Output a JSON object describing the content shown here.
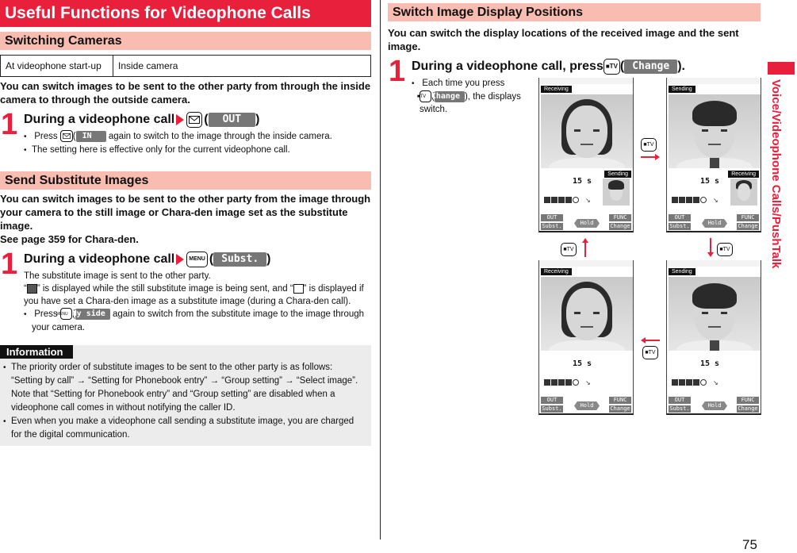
{
  "page": {
    "number": "75",
    "side_tab": "Voice/Videophone Calls/PushTalk",
    "accent_color": "#e8203c",
    "subheading_color": "#f8bcb0"
  },
  "left": {
    "title": "Useful Functions for Videophone Calls",
    "switching_cameras": {
      "heading": "Switching Cameras",
      "table": [
        {
          "setting": "At videophone start-up",
          "value": "Inside camera"
        }
      ],
      "lead": "You can switch images to be sent to the other party from through the inside camera to through the outside camera.",
      "step": {
        "number": "1",
        "title": "During a videophone call",
        "key_icon": "mail-key-icon",
        "softkey": "OUT",
        "bullets": [
          {
            "pre": "Press ",
            "softkey": "IN",
            "post": " again to switch to the image through the inside camera."
          },
          {
            "text": "The setting here is effective only for the current videophone call."
          }
        ]
      }
    },
    "send_substitute": {
      "heading": "Send Substitute Images",
      "lead": "You can switch images to be sent to the other party from the image through your camera to the still image or Chara-den image set as the substitute image.",
      "lead2": "See page 359 for Chara-den.",
      "step": {
        "number": "1",
        "title": "During a videophone call",
        "key_label": "MENU",
        "softkey": "Subst.",
        "body1": "The substitute image is sent to the other party.",
        "body2a": "“",
        "body2b": "” is displayed while the still substitute image is being sent, and “",
        "body2c": "” is displayed if you have set a Chara-den image as a substitute image (during a Chara-den call).",
        "bullet_pre": "Press ",
        "bullet_softkey": "My side",
        "bullet_post": " again to switch from the substitute image to the image through your camera."
      }
    },
    "information": {
      "tag": "Information",
      "items": [
        "The priority order of substitute images to be sent to the other party is as follows: “Setting by call” → “Setting for Phonebook entry” → “Group setting” → “Select image”. Note that “Setting for Phonebook entry” and “Group setting” are disabled when a videophone call comes in without notifying the caller ID.",
        "Even when you make a videophone call sending a substitute image, you are charged for the digital communication."
      ]
    }
  },
  "right": {
    "heading": "Switch Image Display Positions",
    "lead": "You can switch the display locations of the received image and the sent image.",
    "step": {
      "number": "1",
      "title_pre": "During a videophone call, press ",
      "key_label": "■TV",
      "softkey": "Change",
      "title_post": ").",
      "bullet_pre": "Each time you press",
      "bullet_softkey": "Change",
      "bullet_post": "), the displays switch."
    },
    "screens": [
      {
        "main_label": "Receiving",
        "main_person": "female",
        "time": "15 s",
        "sub_label": "Sending",
        "thumb_person": "male",
        "softkeys": [
          "OUT",
          "Subst.",
          "Hold",
          "FUNC",
          "Change"
        ]
      },
      {
        "main_label": "Sending",
        "main_person": "male",
        "time": "15 s",
        "sub_label": "Receiving",
        "thumb_person": "female",
        "softkeys": [
          "OUT",
          "Subst.",
          "Hold",
          "FUNC",
          "Change"
        ]
      },
      {
        "main_label": "Receiving",
        "main_person": "female",
        "time": "15 s",
        "sub_label": "",
        "thumb_person": "",
        "softkeys": [
          "OUT",
          "Subst.",
          "Hold",
          "FUNC",
          "Change"
        ]
      },
      {
        "main_label": "Sending",
        "main_person": "male",
        "time": "15 s",
        "sub_label": "",
        "thumb_person": "",
        "softkeys": [
          "OUT",
          "Subst.",
          "Hold",
          "FUNC",
          "Change"
        ]
      }
    ],
    "cam_key_label": "■TV"
  }
}
